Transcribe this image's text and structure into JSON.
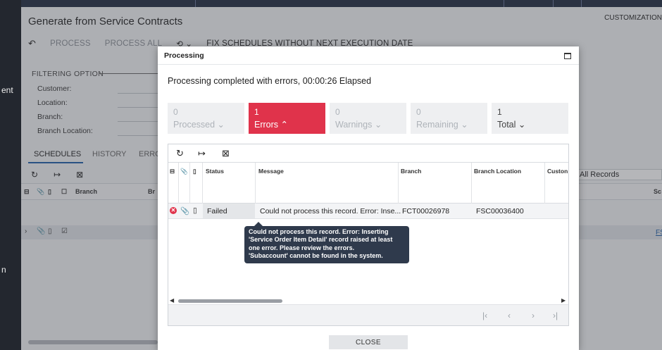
{
  "background": {
    "page_title": "Generate from Service Contracts",
    "customization": "CUSTOMIZATION",
    "toolbar": {
      "process": "PROCESS",
      "process_all": "PROCESS ALL",
      "fix_schedules": "FIX SCHEDULES WITHOUT NEXT EXECUTION DATE"
    },
    "filter": {
      "title": "FILTERING OPTION",
      "customer": "Customer:",
      "location": "Location:",
      "branch": "Branch:",
      "branch_location": "Branch Location:"
    },
    "tabs": [
      "SCHEDULES",
      "HISTORY",
      "ERRO"
    ],
    "grid_headers": [
      "Branch",
      "Br"
    ],
    "records_filter": "All Records",
    "right_col_header": "Sc",
    "row_link": "FS",
    "left_fragments": [
      "ent",
      "n"
    ]
  },
  "dialog": {
    "title": "Processing",
    "status_text": "Processing completed with errors, 00:00:26 Elapsed",
    "stats": [
      {
        "count": "0",
        "label": "Processed",
        "variant": "muted"
      },
      {
        "count": "1",
        "label": "Errors",
        "variant": "error"
      },
      {
        "count": "0",
        "label": "Warnings",
        "variant": "muted"
      },
      {
        "count": "0",
        "label": "Remaining",
        "variant": "muted"
      },
      {
        "count": "1",
        "label": "Total",
        "variant": "total"
      }
    ],
    "grid": {
      "headers": [
        "Status",
        "Message",
        "Branch",
        "Branch Location",
        "Custon"
      ],
      "rows": [
        {
          "status": "Failed",
          "message": "Could not process this record. Error: Inse...",
          "branch": "FCT00026978",
          "branch_location": "FSC00036400"
        }
      ]
    },
    "tooltip": [
      "Could not process this record. Error: Inserting",
      "'Service Order Item Detail' record raised at least",
      "one error. Please review the errors.",
      "'Subaccount' cannot be found in the system."
    ],
    "close_label": "CLOSE"
  },
  "colors": {
    "error": "#e0334b",
    "tooltip_bg": "#2f3a4c",
    "accent_blue": "#1d5ea8"
  }
}
